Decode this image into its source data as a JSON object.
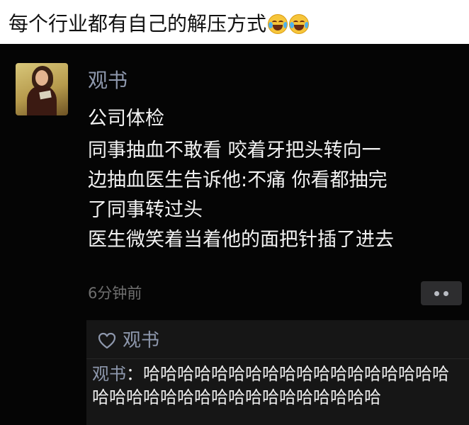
{
  "caption": {
    "text": "每个行业都有自己的解压方式",
    "emojis": [
      "tears-of-joy-emoji",
      "tears-of-joy-emoji"
    ]
  },
  "post": {
    "username": "观书",
    "lines": [
      "公司体检",
      "同事抽血不敢看 咬着牙把头转向一",
      "边抽血医生告诉他:不痛 你看都抽完",
      "了同事转过头",
      "医生微笑着当着他的面把针插了进去"
    ],
    "timestamp": "6分钟前",
    "more_icon": "more-dots-icon"
  },
  "interactions": {
    "like_icon": "heart-outline-icon",
    "liked_by": "观书",
    "comment": {
      "author": "观书",
      "separator": "：",
      "text": "哈哈哈哈哈哈哈哈哈哈哈哈哈哈哈哈哈哈哈哈哈哈哈哈哈哈哈哈哈哈哈哈哈哈哈"
    }
  },
  "colors": {
    "background": "#050505",
    "name_blue": "#8e98ad",
    "text": "#f2f2f2",
    "muted": "#6f6f6f",
    "comment_bg": "#161616"
  }
}
